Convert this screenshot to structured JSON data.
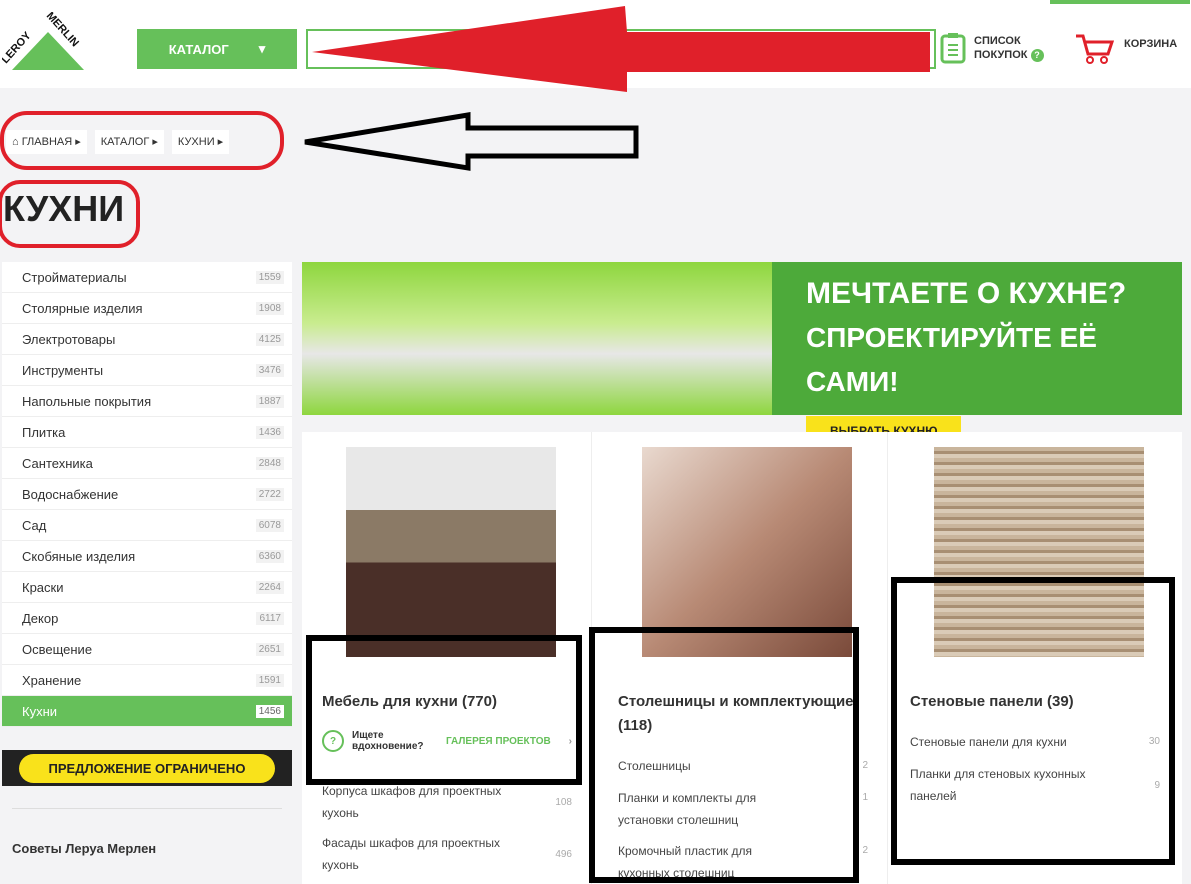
{
  "header": {
    "logo_text": "LEROY MERLIN",
    "catalog_label": "КАТАЛОГ",
    "search_placeholder": "",
    "shopping_list": [
      "СПИСОК",
      "ПОКУПОК"
    ],
    "cart_label": "КОРЗИНА"
  },
  "breadcrumb": [
    "ГЛАВНАЯ",
    "КАТАЛОГ",
    "КУХНИ"
  ],
  "page_title": "КУХНИ",
  "sidebar": {
    "items": [
      {
        "label": "Стройматериалы",
        "count": "1559"
      },
      {
        "label": "Столярные изделия",
        "count": "1908"
      },
      {
        "label": "Электротовары",
        "count": "4125"
      },
      {
        "label": "Инструменты",
        "count": "3476"
      },
      {
        "label": "Напольные покрытия",
        "count": "1887"
      },
      {
        "label": "Плитка",
        "count": "1436"
      },
      {
        "label": "Сантехника",
        "count": "2848"
      },
      {
        "label": "Водоснабжение",
        "count": "2722"
      },
      {
        "label": "Сад",
        "count": "6078"
      },
      {
        "label": "Скобяные изделия",
        "count": "6360"
      },
      {
        "label": "Краски",
        "count": "2264"
      },
      {
        "label": "Декор",
        "count": "6117"
      },
      {
        "label": "Освещение",
        "count": "2651"
      },
      {
        "label": "Хранение",
        "count": "1591"
      },
      {
        "label": "Кухни",
        "count": "1456",
        "active": true
      }
    ],
    "promo": "ПРЕДЛОЖЕНИЕ ОГРАНИЧЕНО",
    "tips_title": "Советы Леруа Мерлен"
  },
  "banner": {
    "line1": "МЕЧТАЕТЕ О КУХНЕ?",
    "line2": "СПРОЕКТИРУЙТЕ ЕЁ САМИ!",
    "button": "ВЫБРАТЬ КУХНЮ"
  },
  "cards": [
    {
      "title": "Мебель для кухни (770)",
      "inspiration": "Ищете вдохновение?",
      "gallery": "ГАЛЕРЕЯ ПРОЕКТОВ",
      "items": [
        {
          "label": "Корпуса шкафов для проектных кухонь",
          "count": "108"
        },
        {
          "label": "Фасады шкафов для проектных кухонь",
          "count": "496"
        }
      ]
    },
    {
      "title": "Столешницы и комплектующие (118)",
      "items": [
        {
          "label": "Столешницы",
          "count": "2"
        },
        {
          "label": "Планки и комплекты для установки столешниц",
          "count": "1"
        },
        {
          "label": "Кромочный пластик для кухонных столешниц",
          "count": "2"
        }
      ]
    },
    {
      "title": "Стеновые панели (39)",
      "items": [
        {
          "label": "Стеновые панели для кухни",
          "count": "30"
        },
        {
          "label": "Планки для стеновых кухонных панелей",
          "count": "9"
        }
      ]
    }
  ],
  "colors": {
    "brand_green": "#66c05a",
    "promo_yellow": "#f9e21b",
    "annotation_red": "#e0202a"
  }
}
